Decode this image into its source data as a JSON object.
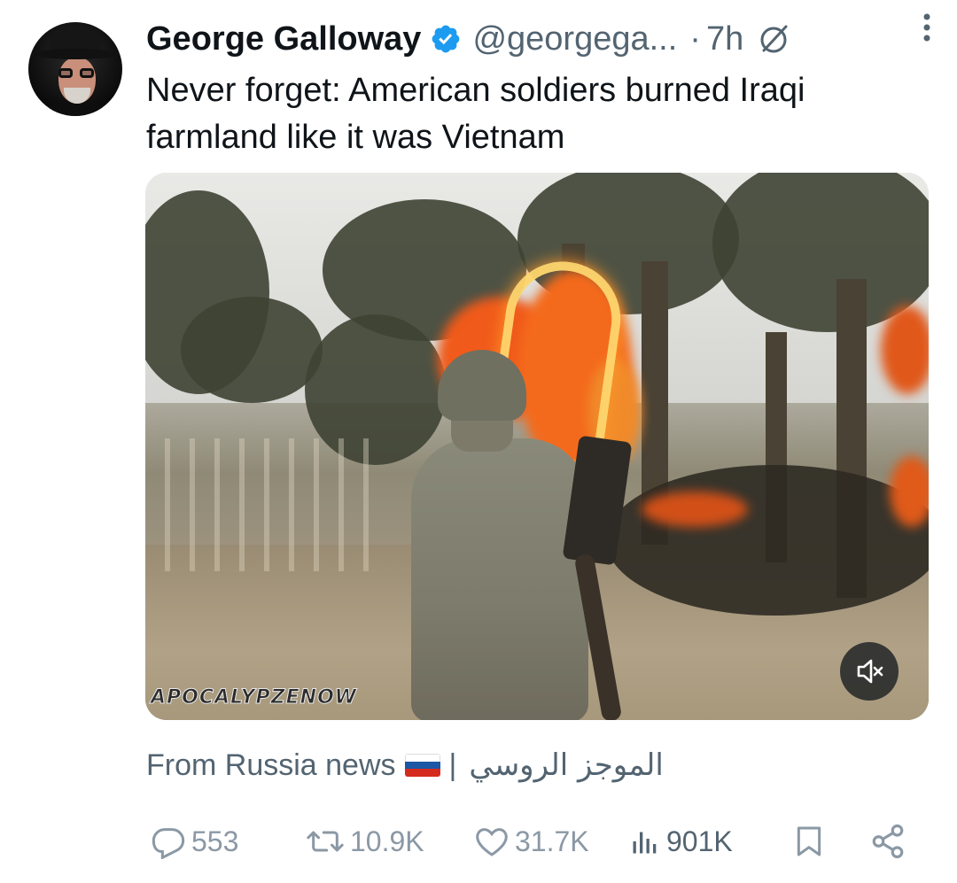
{
  "author": {
    "name": "George Galloway",
    "handle": "@georgega...",
    "separator": "·",
    "time": "7h"
  },
  "icons": {
    "verified": "verified-badge-icon",
    "grok": "grok-icon",
    "more": "more-vertical-icon",
    "mute": "muted-speaker-icon",
    "reply": "reply-icon",
    "retweet": "retweet-icon",
    "like": "heart-icon",
    "views": "views-bar-icon",
    "bookmark": "bookmark-icon",
    "share": "share-icon"
  },
  "colors": {
    "verified_blue": "#1d9bf0",
    "secondary_text": "#536471",
    "action_gray": "#8b98a5"
  },
  "tweet": {
    "text": "Never forget: American soldiers burned Iraqi farmland like it was Vietnam"
  },
  "media": {
    "watermark": "APOCALYPZENOW"
  },
  "source": {
    "label": "From Russia news",
    "divider": "|",
    "arabic": "الموجز الروسي"
  },
  "actions": {
    "replies": "553",
    "retweets": "10.9K",
    "likes": "31.7K",
    "views": "901K"
  }
}
